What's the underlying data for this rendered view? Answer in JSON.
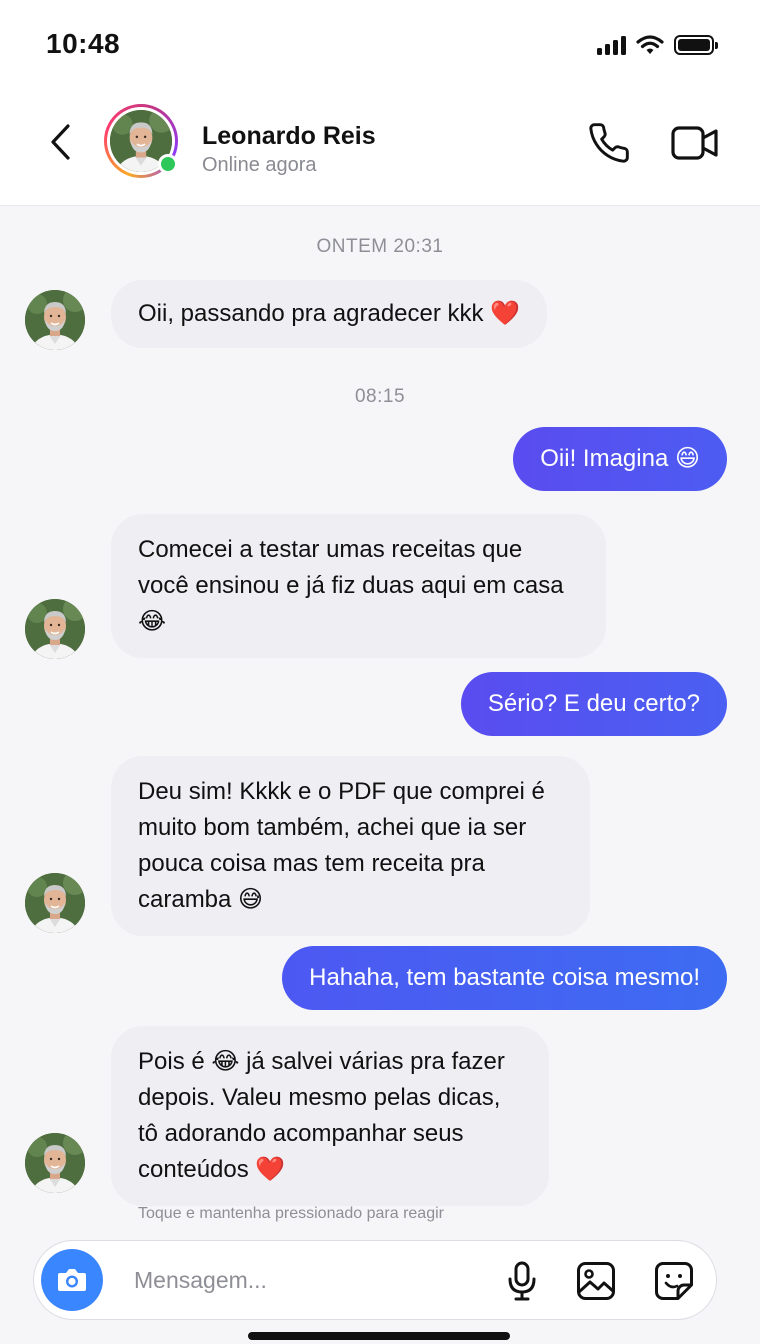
{
  "status_bar": {
    "time": "10:48",
    "icons": [
      "signal-icon",
      "wifi-icon",
      "battery-icon"
    ]
  },
  "header": {
    "contact_name": "Leonardo Reis",
    "contact_status": "Online agora",
    "online": true,
    "actions": [
      "back-icon",
      "phone-icon",
      "video-icon"
    ]
  },
  "conversation": {
    "timestamps": [
      "ONTEM 20:31",
      "08:15"
    ],
    "messages": [
      {
        "from": "contact",
        "text": "Oii, passando pra agradecer kkk ❤️"
      },
      {
        "from": "me",
        "text": "Oii! Imagina 😄"
      },
      {
        "from": "contact",
        "text": "Comecei a testar umas receitas que você ensinou e já fiz duas aqui em casa 😂"
      },
      {
        "from": "me",
        "text": "Sério? E deu certo?"
      },
      {
        "from": "contact",
        "text": "Deu sim! Kkkk e o PDF que comprei é muito bom também, achei que ia ser pouca coisa mas tem receita pra caramba 😅"
      },
      {
        "from": "me",
        "text": "Hahaha, tem bastante coisa mesmo!"
      },
      {
        "from": "contact",
        "text": "Pois é 😂 já salvei várias pra fazer depois. Valeu mesmo pelas dicas, tô adorando acompanhar seus conteúdos ❤️"
      }
    ],
    "reaction_hint": "Toque e mantenha pressionado para reagir"
  },
  "composer": {
    "placeholder": "Mensagem...",
    "value": "",
    "icons": [
      "camera-icon",
      "microphone-icon",
      "gallery-icon",
      "sticker-icon"
    ]
  },
  "colors": {
    "accent": "#3a86ff",
    "outgoing_gradient_start": "#5a4cf0",
    "outgoing_gradient_end": "#3d6cf2",
    "incoming_bubble": "#eeeef3",
    "online_dot": "#2ec85a"
  }
}
